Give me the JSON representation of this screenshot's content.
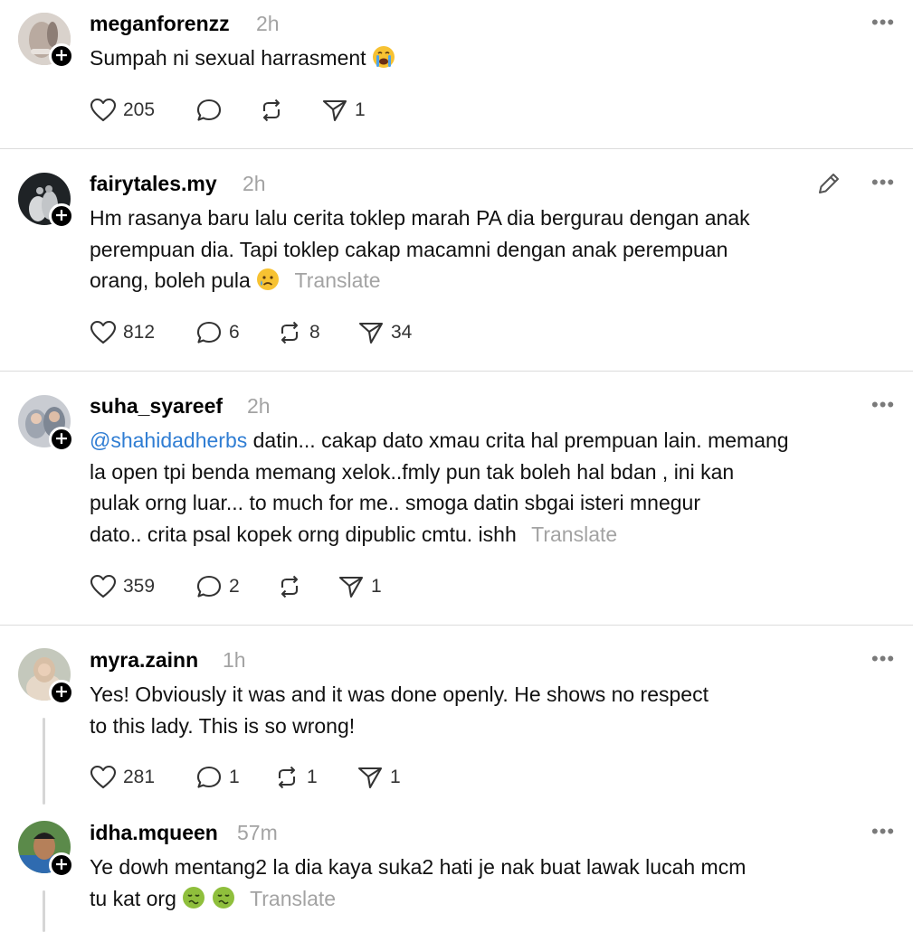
{
  "posts": [
    {
      "username": "meganforenzz",
      "time": "2h",
      "text": "Sumpah ni sexual harrasment",
      "emojis": [
        "crying-face"
      ],
      "likes": "205",
      "replies": "",
      "reposts": "",
      "shares": "1"
    },
    {
      "username": "fairytales.my",
      "time": "2h",
      "line1": "Hm rasanya baru lalu cerita toklep marah PA dia bergurau dengan anak",
      "line2": "perempuan dia. Tapi toklep cakap macamni dengan anak perempuan",
      "line3": "orang, boleh pula",
      "translate": "Translate",
      "likes": "812",
      "replies": "6",
      "reposts": "8",
      "shares": "34"
    },
    {
      "username": "suha_syareef",
      "time": "2h",
      "mention": "@shahidadherbs",
      "line1": " datin... cakap dato xmau crita hal prempuan lain. memang",
      "line2": "la open tpi benda memang xelok..fmly pun tak boleh hal bdan , ini kan",
      "line3": "pulak orng luar... to much for me.. smoga datin sbgai isteri mnegur",
      "line4": "dato.. crita psal kopek orng dipublic cmtu. ishh",
      "translate": "Translate",
      "likes": "359",
      "replies": "2",
      "reposts": "",
      "shares": "1"
    },
    {
      "username": "myra.zainn",
      "time": "1h",
      "line1": "Yes! Obviously it was and it was done openly. He shows no respect",
      "line2": "to this lady. This is so wrong!",
      "likes": "281",
      "replies": "1",
      "reposts": "1",
      "shares": "1"
    },
    {
      "username": "idha.mqueen",
      "time": "57m",
      "line1": "Ye dowh mentang2 la dia kaya suka2 hati je nak buat lawak lucah mcm",
      "line2": "tu kat org",
      "translate": "Translate"
    }
  ],
  "icons": {
    "like": "heart-icon",
    "reply": "speech-bubble-icon",
    "repost": "repost-arrows-icon",
    "share": "paper-plane-icon",
    "more": "more-dots-icon",
    "edit": "pencil-icon",
    "follow": "plus-icon"
  },
  "colors": {
    "mention": "#2f7dd3",
    "muted": "#a3a3a3",
    "divider": "#dcdcdc"
  }
}
